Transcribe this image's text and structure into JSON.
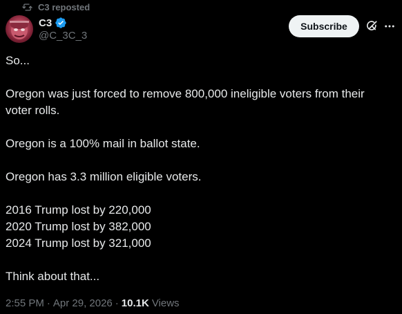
{
  "repost": {
    "text": "C3 reposted",
    "icon": "repost-icon"
  },
  "author": {
    "name": "C3",
    "handle": "@C_3C_3",
    "verified_color": "#1d9bf0",
    "avatar_icon": "avatar"
  },
  "actions": {
    "subscribe_label": "Subscribe",
    "grok_icon": "grok-icon",
    "more_icon": "more-icon"
  },
  "post": {
    "lines": [
      "So...",
      "",
      "Oregon was just forced to remove 800,000 ineligible voters from their",
      "voter rolls.",
      "",
      "Oregon is a 100% mail in ballot state.",
      "",
      "Oregon has 3.3 million eligible voters.",
      "",
      "2016 Trump lost by 220,000",
      "2020 Trump lost by 382,000",
      "2024 Trump lost by 321,000",
      "",
      "Think about that..."
    ]
  },
  "meta": {
    "time": "2:55 PM",
    "sep1": "·",
    "date": "Apr 29, 2026",
    "sep2": "·",
    "views_count": "10.1K",
    "views_label": "Views"
  },
  "colors": {
    "background": "#000000",
    "text": "#e7e9ea",
    "secondary": "#71767b",
    "subscribe_bg": "#eff3f4"
  }
}
